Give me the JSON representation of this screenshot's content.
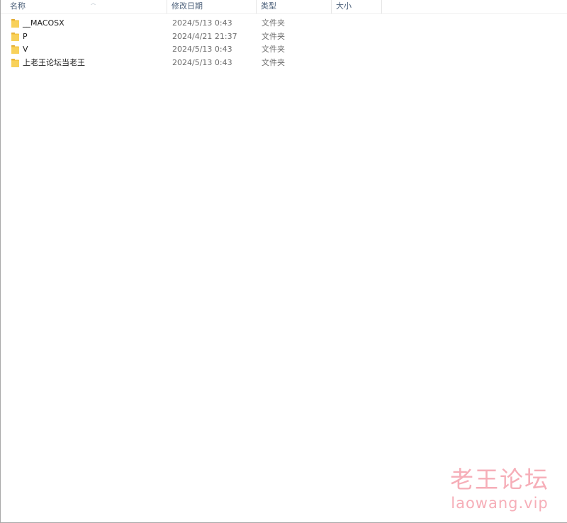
{
  "columns": {
    "name": "名称",
    "date": "修改日期",
    "type": "类型",
    "size": "大小"
  },
  "rows": [
    {
      "name": "__MACOSX",
      "date": "2024/5/13 0:43",
      "type": "文件夹",
      "icon": "folder-icon"
    },
    {
      "name": "P",
      "date": "2024/4/21 21:37",
      "type": "文件夹",
      "icon": "folder-icon"
    },
    {
      "name": "V",
      "date": "2024/5/13 0:43",
      "type": "文件夹",
      "icon": "folder-icon"
    },
    {
      "name": "上老王论坛当老王",
      "date": "2024/5/13 0:43",
      "type": "文件夹",
      "icon": "folder-icon"
    }
  ],
  "watermark": {
    "title": "老王论坛",
    "url": "laowang.vip"
  },
  "colors": {
    "folder": "#f5c542",
    "folder_dark": "#e0a82e",
    "watermark": "#f6a6b1"
  }
}
